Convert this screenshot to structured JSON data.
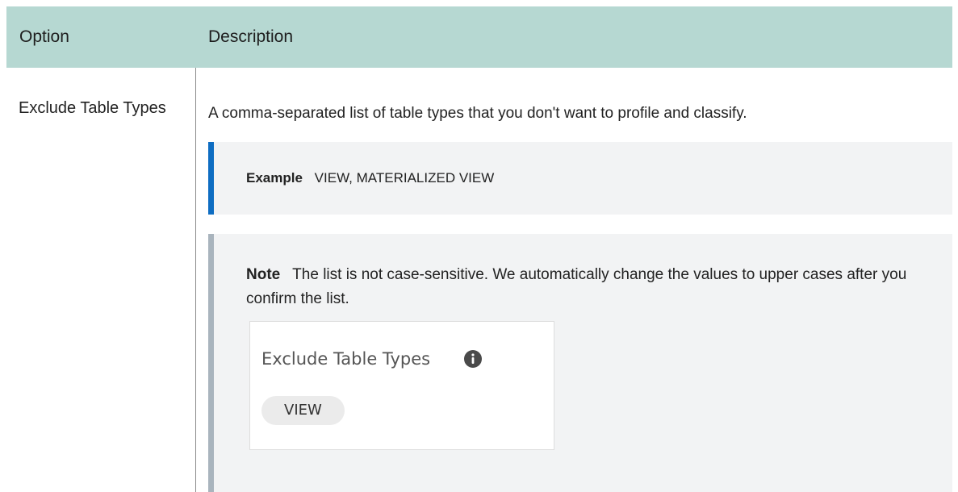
{
  "table": {
    "headers": {
      "option": "Option",
      "description": "Description"
    },
    "row": {
      "option": "Exclude Table Types",
      "description": "A comma-separated list of table types that you don't want to profile and classify.",
      "example": {
        "label": "Example",
        "value": "VIEW, MATERIALIZED VIEW"
      },
      "note": {
        "label": "Note",
        "text": "The list is not case-sensitive. We automatically change the values to upper cases after you confirm the list."
      },
      "field_preview": {
        "label": "Exclude Table Types",
        "icon": "info-icon",
        "chip": "VIEW"
      }
    }
  },
  "colors": {
    "header_bg": "#b6d8d2",
    "example_accent": "#0e6dc2",
    "note_accent": "#a9b4bd",
    "box_bg": "#f2f3f4"
  }
}
